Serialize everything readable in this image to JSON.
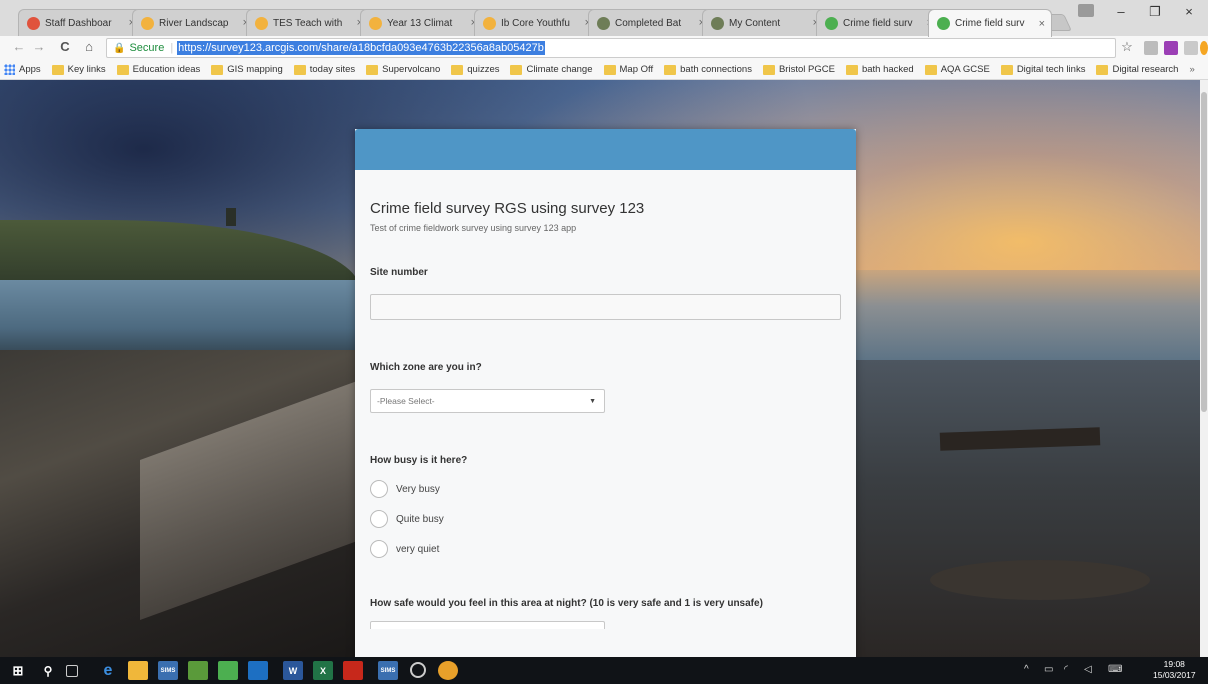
{
  "browser": {
    "tabs": [
      {
        "label": "Staff Dashboar",
        "color": "#e0533d"
      },
      {
        "label": "River Landscap",
        "color": "#f2b23e"
      },
      {
        "label": "TES Teach with",
        "color": "#f2b23e"
      },
      {
        "label": "Year 13 Climat",
        "color": "#f2b23e"
      },
      {
        "label": "Ib Core Youthfu",
        "color": "#f2b23e"
      },
      {
        "label": "Completed Bat",
        "color": "#6e7d57"
      },
      {
        "label": "My Content",
        "color": "#6e7d57"
      },
      {
        "label": "Crime field surv",
        "color": "#4caf50"
      },
      {
        "label": "Crime field surv",
        "color": "#4caf50"
      }
    ],
    "active_tab_index": 8,
    "tab_close_glyph": "×",
    "window_controls": {
      "minimize": "–",
      "maximize": "❐",
      "close": "×"
    },
    "nav": {
      "back": "←",
      "forward": "→",
      "reload": "C",
      "home": "⌂"
    },
    "secure_label": "Secure",
    "url": "https://survey123.arcgis.com/share/a18bcfda093e4763b22356a8ab05427b",
    "star_glyph": "☆",
    "bookmarks": [
      "Apps",
      "Key links",
      "Education ideas",
      "GIS mapping",
      "today sites",
      "Supervolcano",
      "quizzes",
      "Climate change",
      "Map Off",
      "bath connections",
      "Bristol PGCE",
      "bath hacked",
      "AQA GCSE",
      "Digital tech links",
      "Digital research"
    ],
    "bookmarks_more": "»"
  },
  "survey": {
    "title": "Crime field survey RGS using survey 123",
    "description": "Test of crime fieldwork survey using survey 123 app",
    "site_number_label": "Site number",
    "site_number_value": "",
    "zone_label": "Which zone are you in?",
    "zone_selected": "-Please Select-",
    "busy_label": "How busy is it here?",
    "busy_options": [
      "Very busy",
      "Quite busy",
      "very quiet"
    ],
    "safety_label": "How safe would you feel in this area at night? (10 is very safe and 1 is very unsafe)"
  },
  "taskbar": {
    "time": "19:08",
    "date": "15/03/2017",
    "apps": [
      "SIMS",
      "SIMS"
    ]
  },
  "colors": {
    "form_header": "#4f96c6",
    "url_highlight": "#3d7fe0",
    "secure_green": "#1e8e3e"
  }
}
